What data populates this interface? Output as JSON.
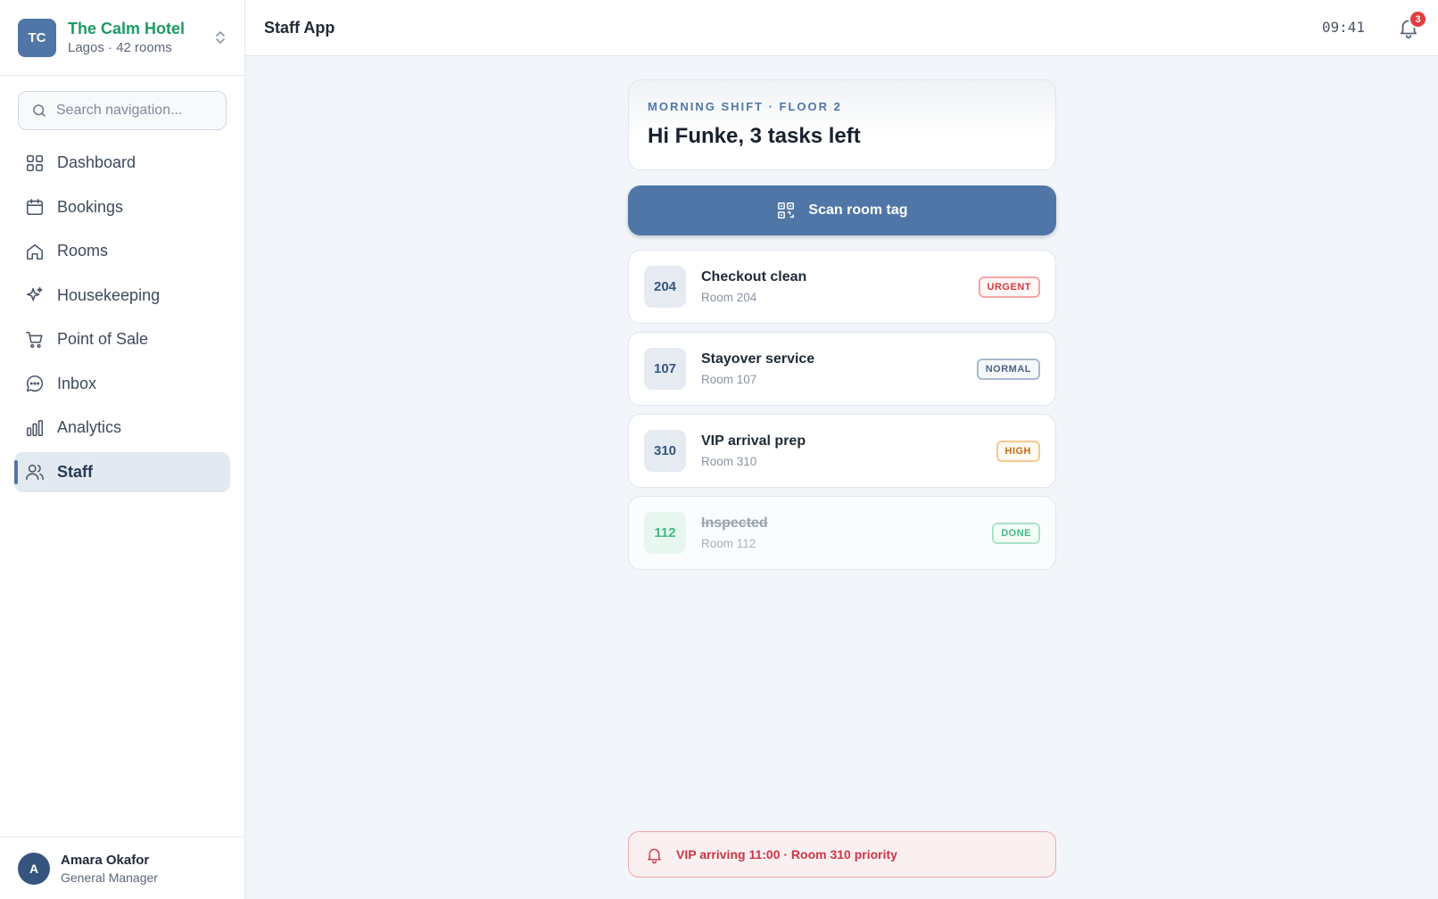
{
  "hotel": {
    "initials": "TC",
    "name": "The Calm Hotel",
    "subtitle": "Lagos · 42 rooms"
  },
  "search": {
    "placeholder": "Search navigation..."
  },
  "nav": {
    "items": [
      {
        "label": "Dashboard",
        "icon": "grid-icon"
      },
      {
        "label": "Bookings",
        "icon": "calendar-icon"
      },
      {
        "label": "Rooms",
        "icon": "home-icon"
      },
      {
        "label": "Housekeeping",
        "icon": "sparkles-icon"
      },
      {
        "label": "Point of Sale",
        "icon": "cart-icon"
      },
      {
        "label": "Inbox",
        "icon": "chat-icon"
      },
      {
        "label": "Analytics",
        "icon": "bar-chart-icon"
      },
      {
        "label": "Staff",
        "icon": "users-icon",
        "active": true
      }
    ]
  },
  "user": {
    "initial": "A",
    "name": "Amara Okafor",
    "role": "General Manager"
  },
  "header": {
    "title": "Staff App",
    "time": "09:41",
    "notifications": "3"
  },
  "shift": {
    "eyebrow": "MORNING SHIFT · FLOOR 2",
    "greeting": "Hi Funke, 3 tasks left"
  },
  "scan": {
    "label": "Scan room tag"
  },
  "tasks": [
    {
      "room": "204",
      "title": "Checkout clean",
      "subtitle": "Room 204",
      "priority": "URGENT"
    },
    {
      "room": "107",
      "title": "Stayover service",
      "subtitle": "Room 107",
      "priority": "NORMAL"
    },
    {
      "room": "310",
      "title": "VIP arrival prep",
      "subtitle": "Room 310",
      "priority": "HIGH"
    },
    {
      "room": "112",
      "title": "Inspected",
      "subtitle": "Room 112",
      "priority": "DONE"
    }
  ],
  "alert": {
    "text": "VIP arriving 11:00 · Room 310 priority"
  },
  "colors": {
    "accent": "#4f76a6",
    "brand_green": "#1d9a63",
    "urgent": "#d53a3a",
    "high": "#c26a14",
    "done": "#46b883"
  }
}
